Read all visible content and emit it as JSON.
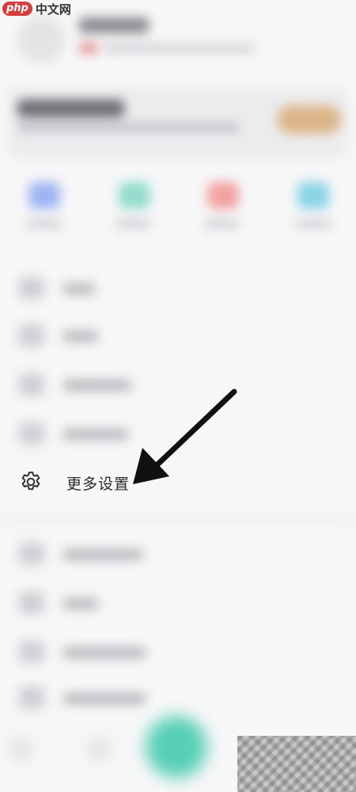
{
  "watermark": {
    "logo": "php",
    "text": "中文网"
  },
  "menu": {
    "highlighted_item": {
      "label": "更多设置",
      "icon": "gear-icon"
    }
  },
  "colors": {
    "fab": "#58cfb6",
    "vip_button": "#dcb58a",
    "arrow": "#111111",
    "quick_icons": [
      "#9db4f3",
      "#93dccb",
      "#f2a1a1",
      "#88d3e6"
    ]
  }
}
